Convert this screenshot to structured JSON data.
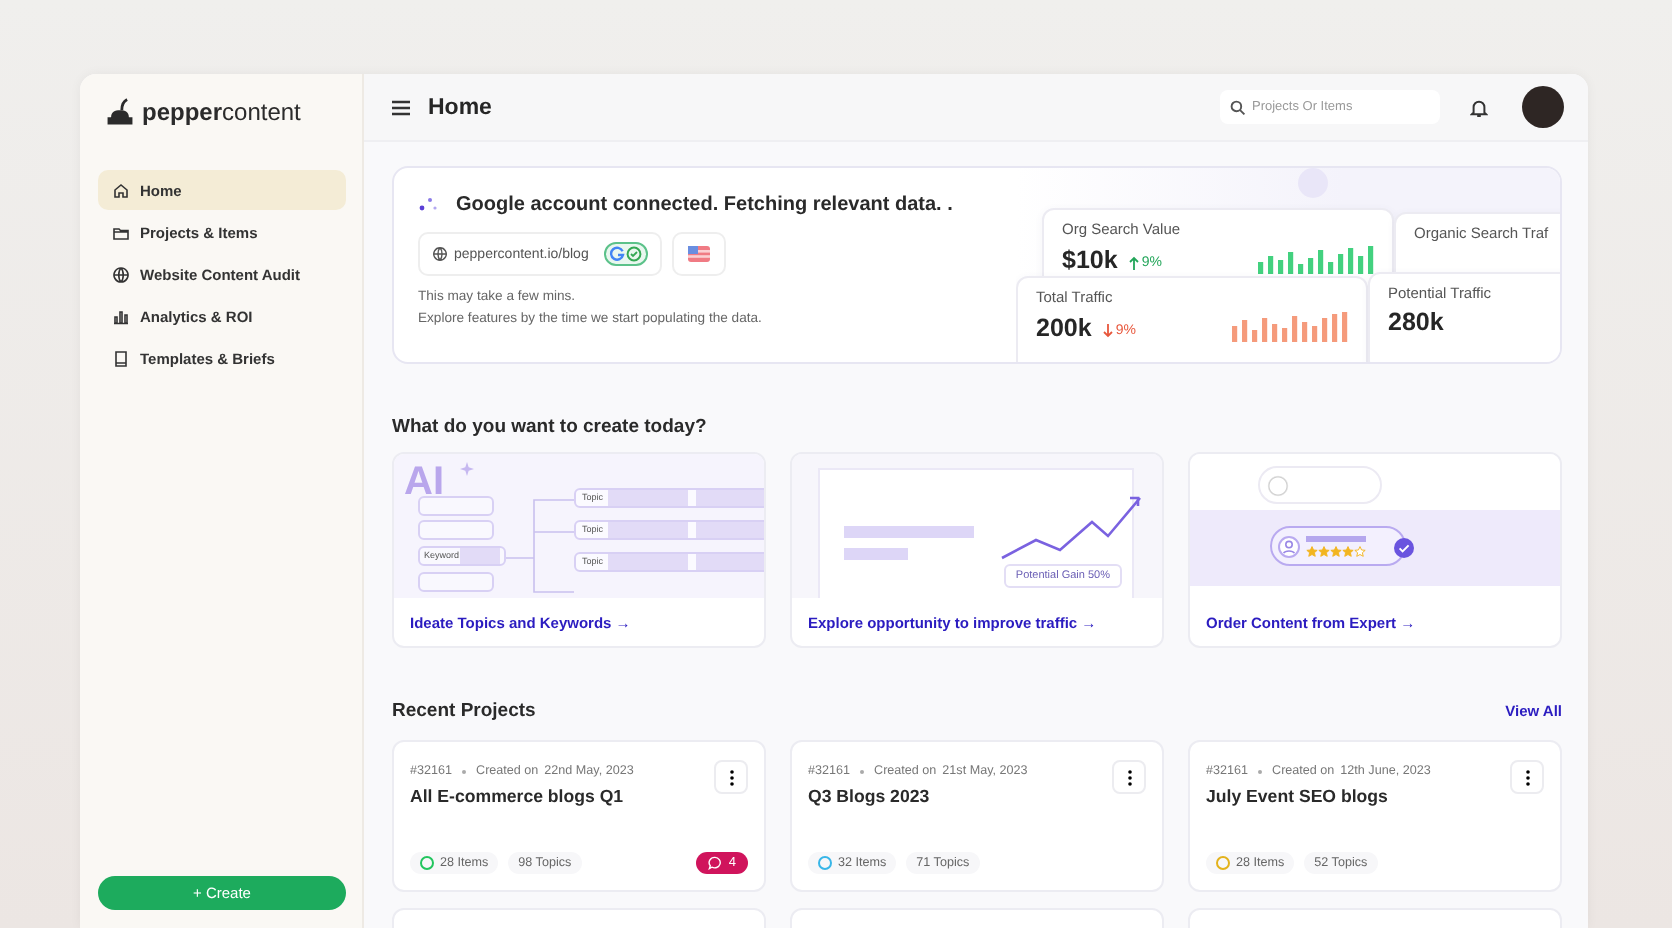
{
  "sidebar": {
    "logo": "**pepper**content",
    "nav": [
      {
        "label": "Home",
        "selected": true
      },
      {
        "label": "Projects & Items",
        "selected": false
      },
      {
        "label": "Website Content Audit",
        "selected": false
      },
      {
        "label": "Analytics & ROI",
        "selected": false
      },
      {
        "label": "Templates & Briefs",
        "selected": false
      }
    ],
    "create_button": "+ Create"
  },
  "header": {
    "title": "Home",
    "search": {
      "placeholder": "Projects Or Items"
    }
  },
  "banner": {
    "headline": "Google account connected. Fetching relevant data. .",
    "url": "peppercontent.io/blog",
    "note_lines": [
      "This may take a few mins.",
      "Explore features by the time we start populating the data."
    ],
    "stats": [
      {
        "label": "Org Search Value",
        "value": "$10k",
        "change": "9%",
        "up": true
      },
      {
        "label": "Organic Search Traf"
      },
      {
        "label": "Total Traffic",
        "value": "200k",
        "change": "9%",
        "up": false
      },
      {
        "label": "Potential Traffic",
        "value": "280k"
      }
    ]
  },
  "create": {
    "heading": "What do you want to create today?",
    "options": [
      {
        "kind": "ideate",
        "link": "Ideate Topics and Keywords →",
        "badge": "AI",
        "keyword": "Keyword",
        "topics": [
          "Topic",
          "Topic",
          "Topic"
        ]
      },
      {
        "kind": "traffic",
        "link": "Explore opportunity to improve traffic →",
        "gain": "Potential Gain 50%"
      },
      {
        "kind": "expert",
        "link": "Order Content from Expert →",
        "stars": 4
      }
    ]
  },
  "recent": {
    "heading": "Recent Projects",
    "view_all": "View All",
    "projects": [
      {
        "id": "#32161",
        "created_label": "Created on",
        "date": "22nd May, 2023",
        "title": "All E-commerce blogs Q1",
        "items": "28 Items",
        "topics": "98 Topics",
        "color": "#22c55e",
        "comments": "4"
      },
      {
        "id": "#32161",
        "created_label": "Created on",
        "date": "21st May, 2023",
        "title": "Q3 Blogs 2023",
        "items": "32 Items",
        "topics": "71 Topics",
        "color": "#38b6e8"
      },
      {
        "id": "#32161",
        "created_label": "Created on",
        "date": "12th June, 2023",
        "title": "July Event SEO blogs",
        "items": "28 Items",
        "topics": "52 Topics",
        "color": "#e3b21b"
      }
    ]
  }
}
